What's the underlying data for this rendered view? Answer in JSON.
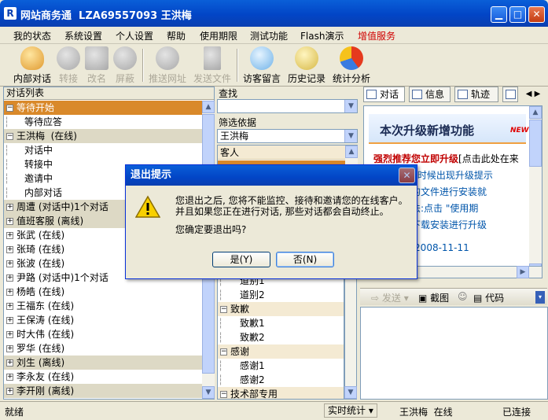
{
  "window": {
    "title": "网站商务通  LZA69557093 王洪梅",
    "app_icon": "R"
  },
  "menu": [
    "我的状态",
    "系统设置",
    "个人设置",
    "帮助",
    "使用期限",
    "测试功能",
    "Flash演示",
    "增值服务"
  ],
  "toolbar": {
    "buttons": [
      {
        "label": "内部对话",
        "icon": "internal-chat-icon",
        "enabled": true
      },
      {
        "label": "转接",
        "icon": "transfer-icon",
        "enabled": false
      },
      {
        "label": "改名",
        "icon": "rename-icon",
        "enabled": false
      },
      {
        "label": "屏蔽",
        "icon": "block-icon",
        "enabled": false
      },
      {
        "label": "推送网址",
        "icon": "push-url-icon",
        "enabled": false
      },
      {
        "label": "发送文件",
        "icon": "send-file-icon",
        "enabled": false
      },
      {
        "label": "访客留言",
        "icon": "visitor-message-icon",
        "enabled": true
      },
      {
        "label": "历史记录",
        "icon": "history-icon",
        "enabled": true
      },
      {
        "label": "统计分析",
        "icon": "statistics-icon",
        "enabled": true
      }
    ]
  },
  "left": {
    "header": "对话列表",
    "rows": [
      {
        "text": "等待开始",
        "type": "group-selected",
        "toggle": "−"
      },
      {
        "text": "等待应答",
        "type": "child"
      },
      {
        "text": "王洪梅  (在线)",
        "type": "group",
        "toggle": "−"
      },
      {
        "text": "对话中",
        "type": "child"
      },
      {
        "text": "转接中",
        "type": "child"
      },
      {
        "text": "邀请中",
        "type": "child"
      },
      {
        "text": "内部对话",
        "type": "child"
      },
      {
        "text": "周遭 (对话中)1个对话",
        "type": "group",
        "toggle": "+"
      },
      {
        "text": "值班客服 (离线)",
        "type": "group",
        "toggle": "+"
      },
      {
        "text": "张武 (在线)",
        "type": "item",
        "toggle": "+"
      },
      {
        "text": "张琦 (在线)",
        "type": "item",
        "toggle": "+"
      },
      {
        "text": "张波 (在线)",
        "type": "item",
        "toggle": "+"
      },
      {
        "text": "尹路 (对话中)1个对话",
        "type": "item",
        "toggle": "+"
      },
      {
        "text": "杨皓 (在线)",
        "type": "item",
        "toggle": "+"
      },
      {
        "text": "王福东 (在线)",
        "type": "item",
        "toggle": "+"
      },
      {
        "text": "王保涛 (在线)",
        "type": "item",
        "toggle": "+"
      },
      {
        "text": "时大伟 (在线)",
        "type": "item",
        "toggle": "+"
      },
      {
        "text": "罗华 (在线)",
        "type": "item",
        "toggle": "+"
      },
      {
        "text": "刘生 (离线)",
        "type": "group",
        "toggle": "+"
      },
      {
        "text": "李永友 (在线)",
        "type": "item",
        "toggle": "+"
      },
      {
        "text": "李开刚 (离线)",
        "type": "group",
        "toggle": "+"
      }
    ]
  },
  "middle": {
    "search_label": "查找",
    "search_value": "",
    "filter_label": "筛选依据",
    "filter_value": "王洪梅",
    "list_top": "客人",
    "tree": [
      {
        "text": "道别1",
        "type": "child"
      },
      {
        "text": "道别2",
        "type": "child"
      },
      {
        "text": "致歉",
        "type": "group"
      },
      {
        "text": "致歉1",
        "type": "child"
      },
      {
        "text": "致歉2",
        "type": "child"
      },
      {
        "text": "感谢",
        "type": "group"
      },
      {
        "text": "感谢1",
        "type": "child"
      },
      {
        "text": "感谢2",
        "type": "child"
      },
      {
        "text": "技术部专用",
        "type": "group"
      }
    ]
  },
  "right": {
    "tabs": [
      "对话",
      "信息",
      "轨迹"
    ],
    "banner": "本次升级新增功能",
    "new_badge": "NEW",
    "lines": [
      {
        "text": "强烈推荐您立即升级",
        "suffix": "[点击此处在来",
        "color": "#c00000"
      },
      {
        "text": "法: 登录的时候出现升级提示",
        "color": "#0055aa"
      },
      {
        "text": "刚刚保存的文件进行安装就",
        "color": "#0055aa"
      },
      {
        "text": "本号的方法:点击 \"使用期",
        "color": "#0055aa"
      },
      {
        "text": "您也手动下载安装进行升级",
        "color": "#0055aa"
      },
      {
        "text": "发布时间:2008-11-11",
        "color": "#0055aa"
      }
    ],
    "compose_bar": {
      "send": "发送",
      "screenshot": "截图",
      "code": "代码"
    }
  },
  "status": {
    "left": "就绪",
    "stats": "实时统计",
    "user": "王洪梅  在线",
    "conn": "已连接"
  },
  "dialog": {
    "title": "退出提示",
    "message_line1": "您退出之后, 您将不能监控、接待和邀请您的在线客户。",
    "message_line2": "并且如果您正在进行对话, 那些对话都会自动终止。",
    "question": "您确定要退出吗?",
    "yes": "是(Y)",
    "no": "否(N)"
  },
  "colors": {
    "title_bar": "#0245c6",
    "selection": "#d9892a",
    "group_bg": "#ddd9c5",
    "link_red": "#c00000"
  }
}
